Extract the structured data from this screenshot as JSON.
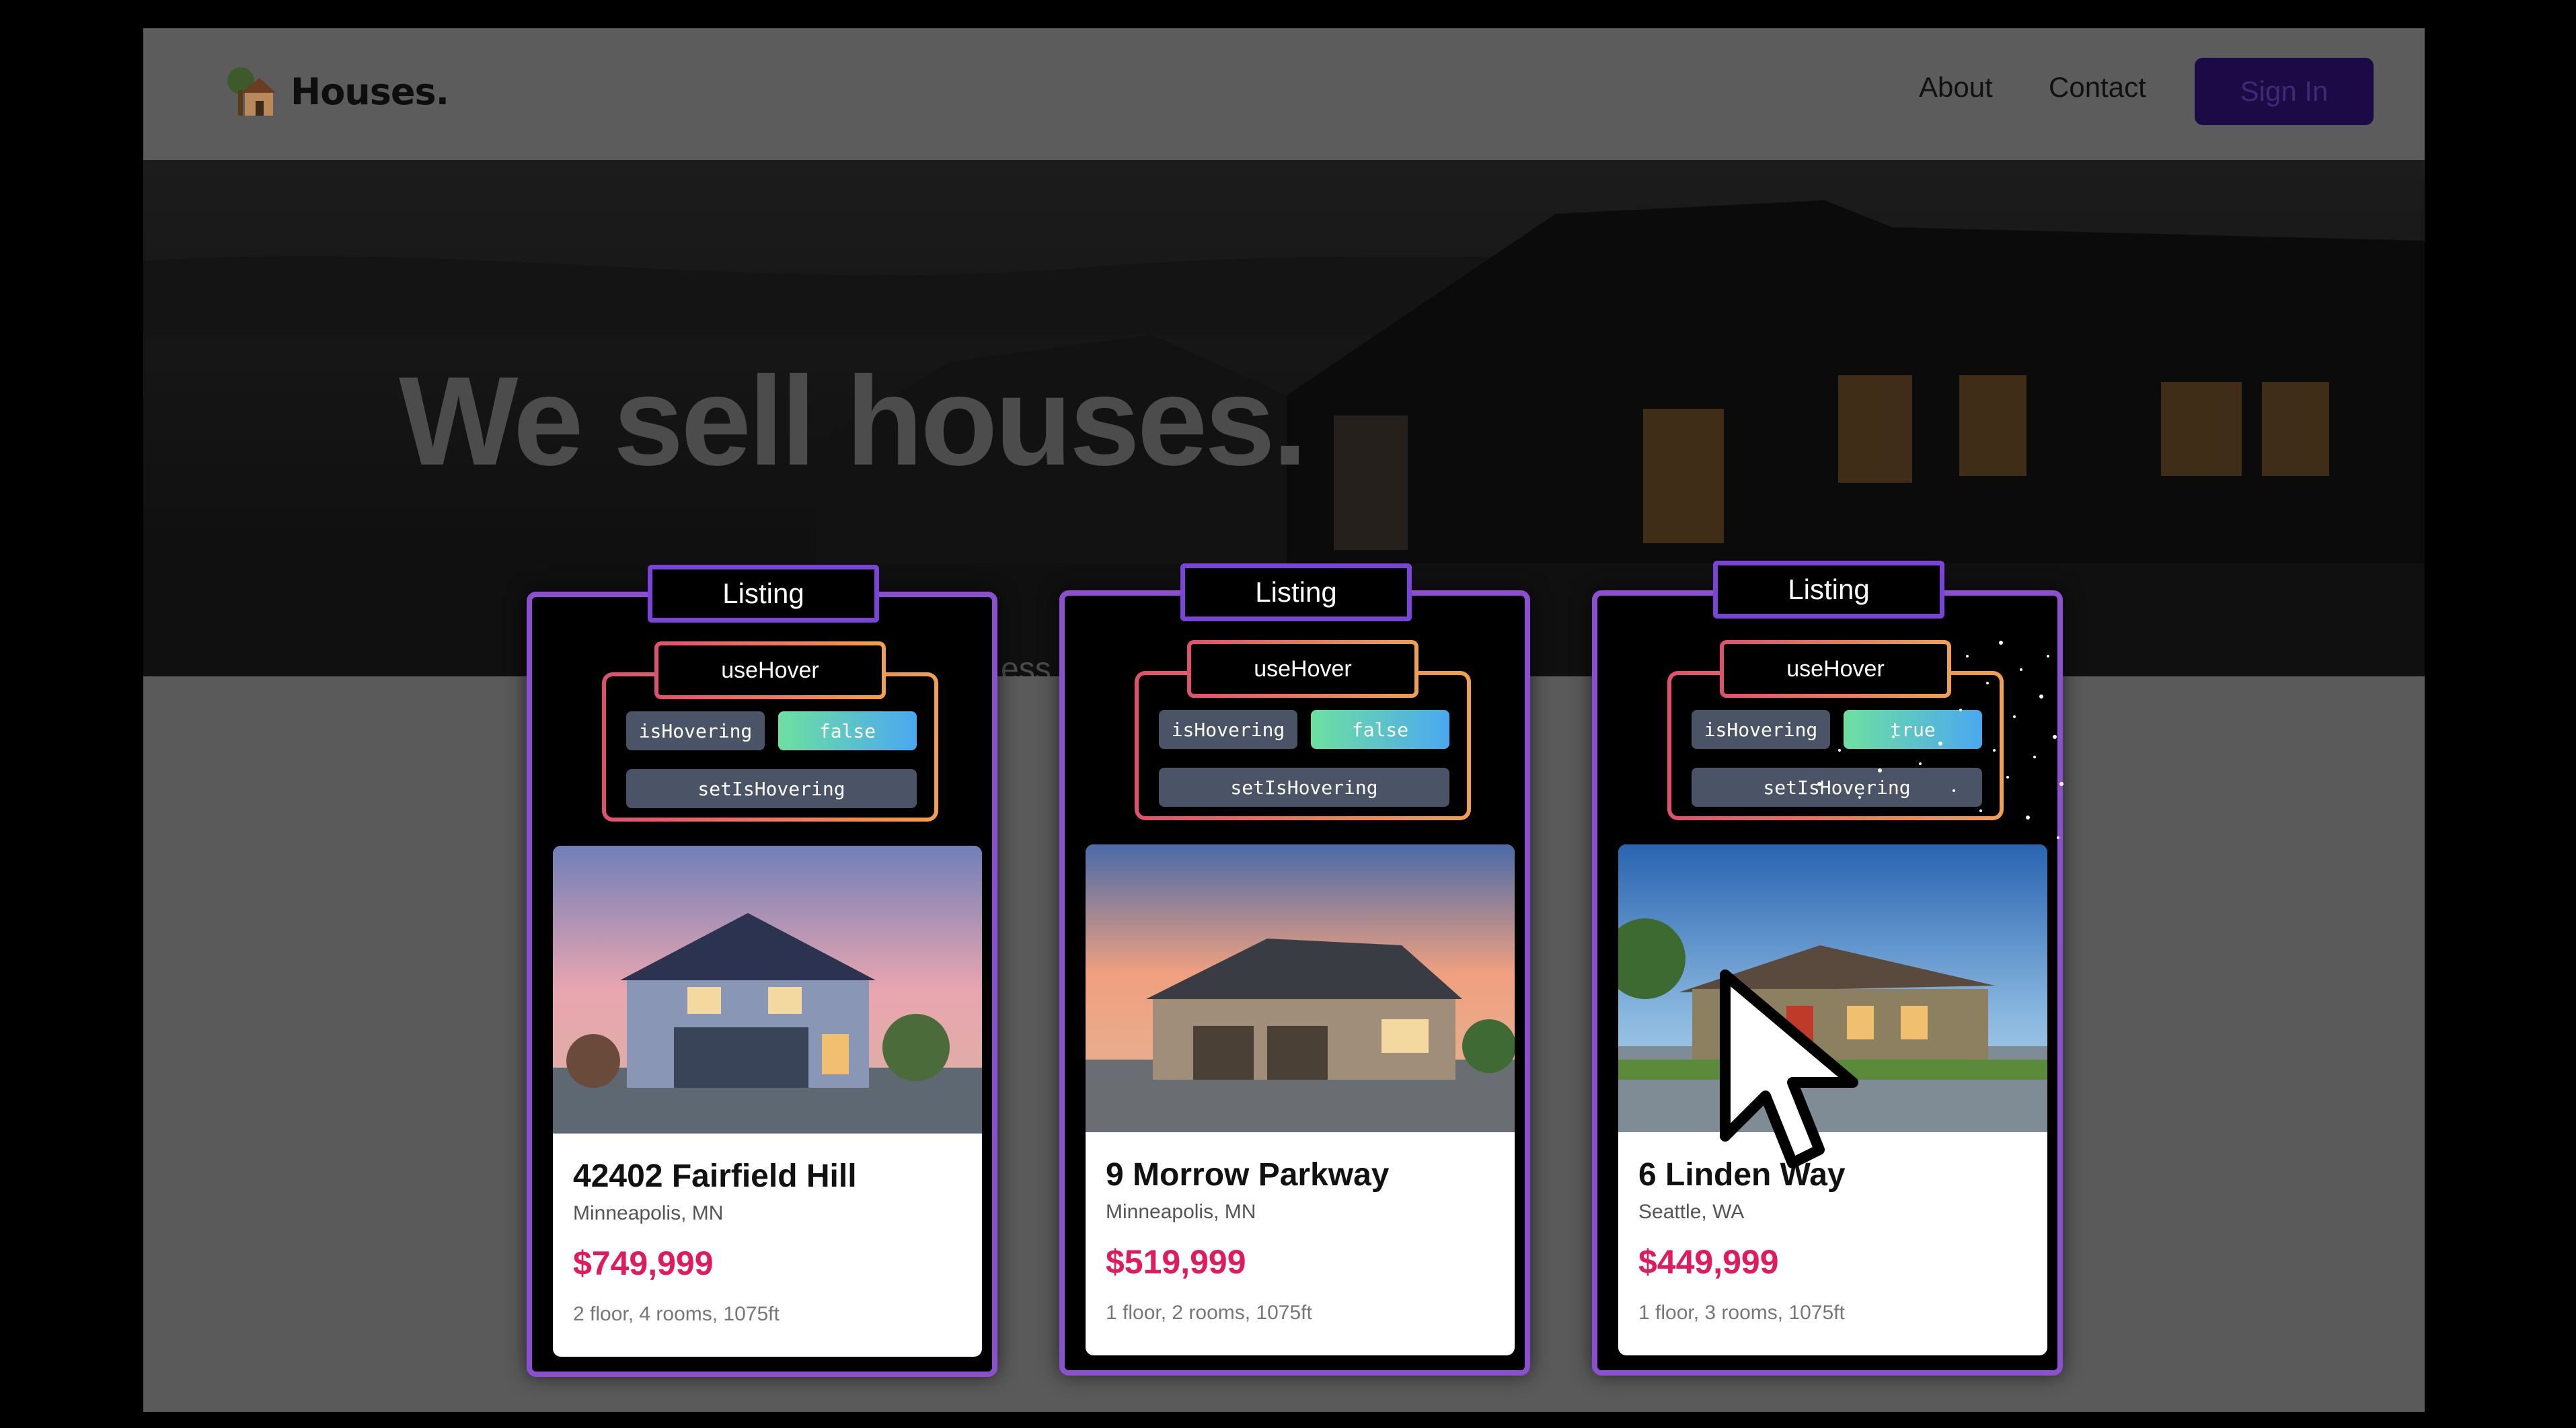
{
  "brand": {
    "name": "Houses."
  },
  "nav": {
    "about": "About",
    "contact": "Contact",
    "sign_in": "Sign In"
  },
  "hero": {
    "title": "We sell houses.",
    "subtitle_fragment": "ess,"
  },
  "component": {
    "listing_label": "Listing",
    "hook_label": "useHover",
    "state_label": "isHovering",
    "setter_label": "setIsHovering"
  },
  "listings": [
    {
      "address": "42402 Fairfield Hill",
      "city": "Minneapolis, MN",
      "price": "$749,999",
      "details": "2 floor, 4 rooms, 1075ft",
      "is_hovering": "false"
    },
    {
      "address": "9 Morrow Parkway",
      "city": "Minneapolis, MN",
      "price": "$519,999",
      "details": "1 floor, 2 rooms, 1075ft",
      "is_hovering": "false"
    },
    {
      "address": "6 Linden Way",
      "city": "Seattle, WA",
      "price": "$449,999",
      "details": "1 floor, 3 rooms, 1075ft",
      "is_hovering": "true"
    }
  ],
  "colors": {
    "accent_purple": "#8b4fd0",
    "price_pink": "#e3195e",
    "signin_bg": "#1b0a45"
  }
}
